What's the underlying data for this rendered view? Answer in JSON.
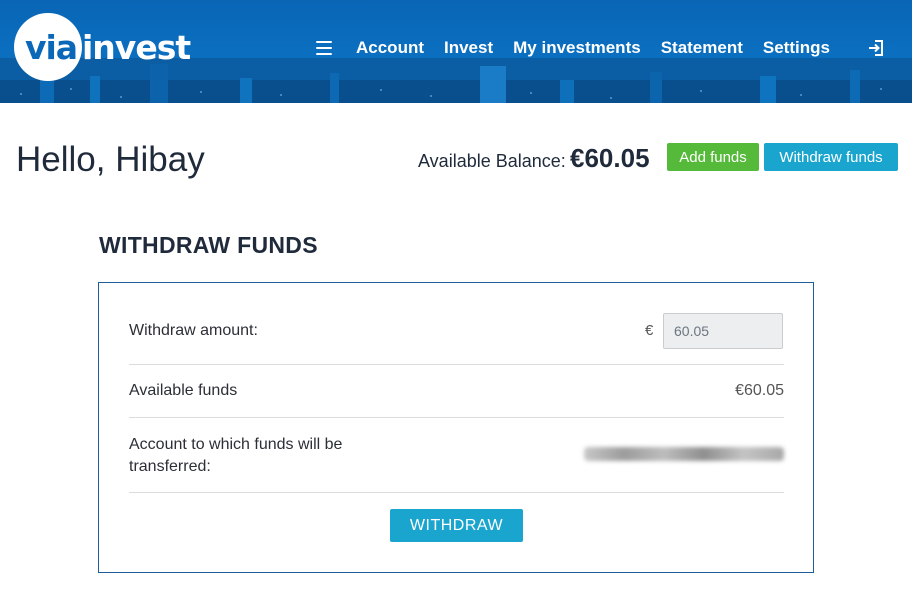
{
  "header": {
    "logo": {
      "part1": "via",
      "part2": "invest"
    },
    "nav": [
      "Account",
      "Invest",
      "My investments",
      "Statement",
      "Settings"
    ],
    "menu_icon": "hamburger-icon",
    "logout_icon": "logout-icon"
  },
  "greeting": "Hello, Hibay",
  "balance": {
    "label": "Available Balance:",
    "value": "€60.05"
  },
  "actions": {
    "add_funds": "Add funds",
    "withdraw_funds": "Withdraw funds"
  },
  "withdraw": {
    "title": "WITHDRAW FUNDS",
    "amount_label": "Withdraw amount:",
    "currency": "€",
    "amount_value": "60.05",
    "available_label": "Available funds",
    "available_value": "€60.05",
    "account_label": "Account to which funds will be transferred:",
    "submit_label": "WITHDRAW"
  },
  "colors": {
    "header_blue": "#0b6fc0",
    "green": "#55b93a",
    "cyan": "#1aa5cf",
    "panel_border": "#1d5d98"
  }
}
